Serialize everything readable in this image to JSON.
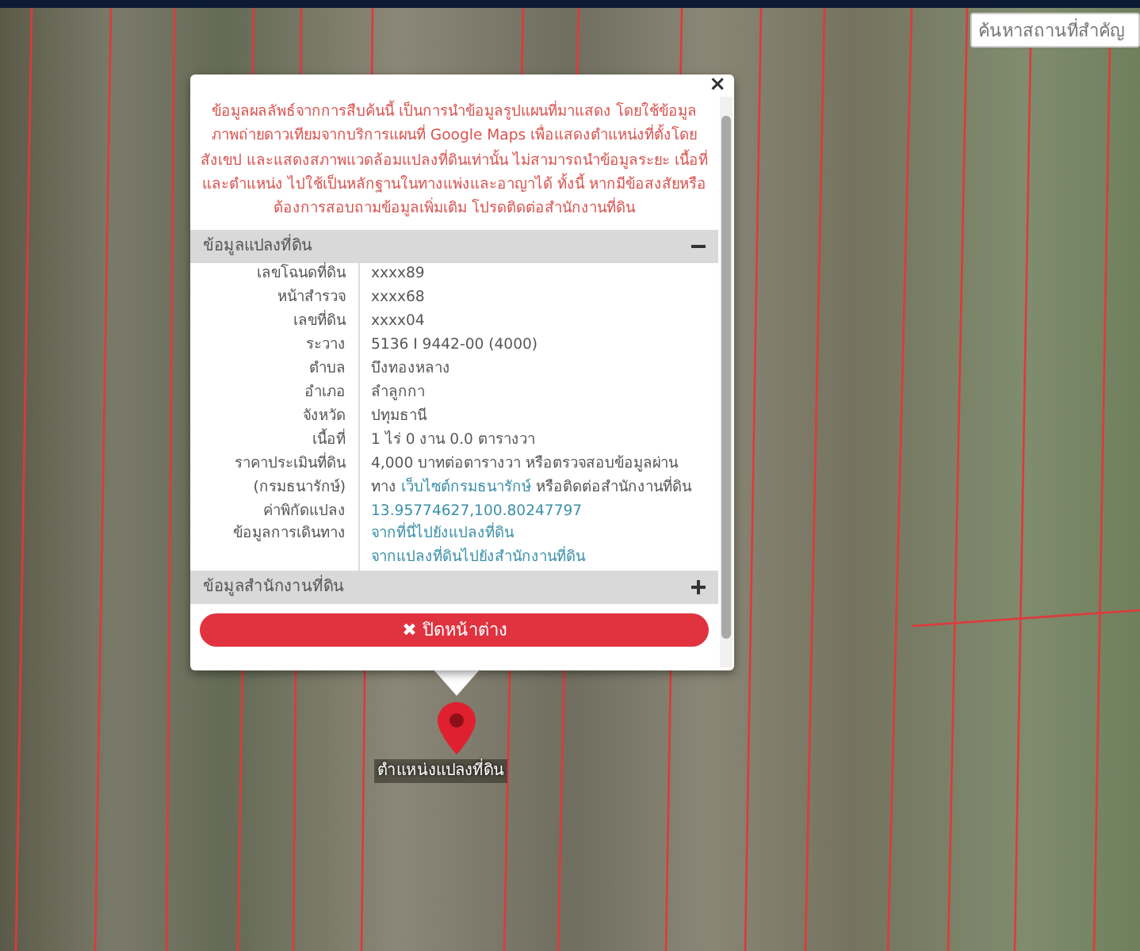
{
  "search": {
    "placeholder": "ค้นหาสถานที่สำคัญ"
  },
  "popup": {
    "close": "×",
    "notice": "ข้อมูลผลลัพธ์จากการสืบค้นนี้ เป็นการนำข้อมูลรูปแผนที่มาแสดง โดยใช้ข้อมูลภาพถ่ายดาวเทียมจากบริการแผนที่ Google Maps เพื่อแสดงตำแหน่งที่ตั้งโดยสังเขป และแสดงสภาพแวดล้อมแปลงที่ดินเท่านั้น ไม่สามารถนำข้อมูลระยะ เนื้อที่ และตำแหน่ง ไปใช้เป็นหลักฐานในทางแพ่งและอาญาได้ ทั้งนี้ หากมีข้อสงสัยหรือต้องการสอบถามข้อมูลเพิ่มเติม โปรดติดต่อสำนักงานที่ดิน",
    "sections": [
      {
        "title": "ข้อมูลแปลงที่ดิน",
        "expanded": true,
        "rows": [
          {
            "label": "เลขโฉนดที่ดิน",
            "parts": [
              {
                "kind": "text",
                "text": "xxxx89"
              }
            ]
          },
          {
            "label": "หน้าสำรวจ",
            "parts": [
              {
                "kind": "text",
                "text": "xxxx68"
              }
            ]
          },
          {
            "label": "เลขที่ดิน",
            "parts": [
              {
                "kind": "text",
                "text": "xxxx04"
              }
            ]
          },
          {
            "label": "ระวาง",
            "parts": [
              {
                "kind": "text",
                "text": "5136 I 9442-00 (4000)"
              }
            ]
          },
          {
            "label": "ตำบล",
            "parts": [
              {
                "kind": "text",
                "text": "บึงทองหลาง"
              }
            ]
          },
          {
            "label": "อำเภอ",
            "parts": [
              {
                "kind": "text",
                "text": "ลำลูกกา"
              }
            ]
          },
          {
            "label": "จังหวัด",
            "parts": [
              {
                "kind": "text",
                "text": "ปทุมธานี"
              }
            ]
          },
          {
            "label": "เนื้อที่",
            "parts": [
              {
                "kind": "text",
                "text": "1 ไร่ 0 งาน 0.0 ตารางวา"
              }
            ]
          },
          {
            "label": "ราคาประเมินที่ดิน",
            "parts": [
              {
                "kind": "text",
                "text": "4,000 บาทต่อตารางวา หรือตรวจสอบข้อมูลผ่าน"
              }
            ]
          },
          {
            "label": "(กรมธนารักษ์)",
            "parts": [
              {
                "kind": "text",
                "text": "ทาง "
              },
              {
                "kind": "link",
                "text": "เว็บไซต์กรมธนารักษ์"
              },
              {
                "kind": "text",
                "text": " หรือติดต่อสำนักงานที่ดิน"
              }
            ]
          },
          {
            "label": "ค่าพิกัดแปลง",
            "parts": [
              {
                "kind": "link",
                "text": "13.95774627,100.80247797"
              }
            ]
          },
          {
            "label": "ข้อมูลการเดินทาง",
            "parts": [
              {
                "kind": "link",
                "text": "จากที่นี่ไปยังแปลงที่ดิน"
              }
            ]
          },
          {
            "parts": [
              {
                "kind": "link",
                "text": "จากแปลงที่ดินไปยังสำนักงานที่ดิน"
              }
            ]
          }
        ]
      },
      {
        "title": "ข้อมูลสำนักงานที่ดิน",
        "expanded": false
      }
    ],
    "button": {
      "icon": "✖",
      "label": "ปิดหน้าต่าง"
    }
  },
  "marker": {
    "label": "ตำแหน่งแปลงที่ดิน"
  }
}
